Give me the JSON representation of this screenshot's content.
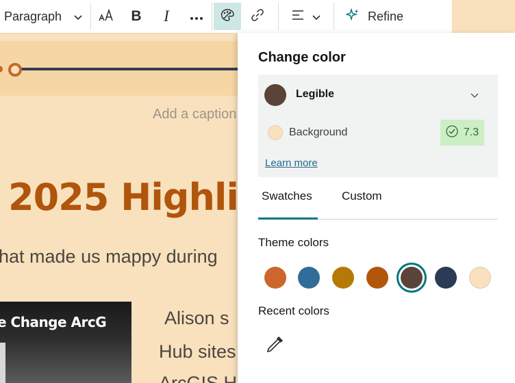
{
  "toolbar": {
    "paragraph_label": "Paragraph",
    "paragraph_icon": "chevron-down-icon",
    "text_size_icon": "text-size-icon",
    "bold_label": "B",
    "italic_label": "I",
    "more_icon": "more-horizontal-icon",
    "color_icon": "palette-icon",
    "link_icon": "link-icon",
    "align_icon": "align-left-icon",
    "refine_label": "Refine",
    "refine_icon": "sparkle-icon",
    "active_color": "#cde7e5"
  },
  "story": {
    "caption_placeholder": "Add a caption",
    "title": "2025 Highli",
    "subtitle": "hat made us mappy during",
    "video_text": "e Change ArcG",
    "body_lines": [
      "Alison s",
      "Hub sites",
      "ArcGIS H"
    ],
    "title_color": "#b0550c",
    "background_color": "#f9e1bd"
  },
  "color_panel": {
    "title": "Change color",
    "foreground": {
      "label": "Legible",
      "color": "#5a4337"
    },
    "background": {
      "label": "Background",
      "color": "#f9e1bd"
    },
    "contrast_ratio": "7.3",
    "learn_more": "Learn more",
    "tabs": [
      {
        "label": "Swatches",
        "selected": true
      },
      {
        "label": "Custom",
        "selected": false
      }
    ],
    "theme_colors_label": "Theme colors",
    "theme_colors": [
      {
        "name": "orange",
        "color": "#cc662c",
        "selected": false
      },
      {
        "name": "blue",
        "color": "#316d98",
        "selected": false
      },
      {
        "name": "gold",
        "color": "#b57a05",
        "selected": false
      },
      {
        "name": "rust",
        "color": "#b2560b",
        "selected": false
      },
      {
        "name": "brown",
        "color": "#5a4337",
        "selected": true
      },
      {
        "name": "navy",
        "color": "#2b3a55",
        "selected": false
      },
      {
        "name": "cream",
        "color": "#f9e1bd",
        "selected": false
      }
    ],
    "recent_colors_label": "Recent colors",
    "eyedropper_icon": "eyedropper-icon",
    "accent_color": "#00777c"
  }
}
